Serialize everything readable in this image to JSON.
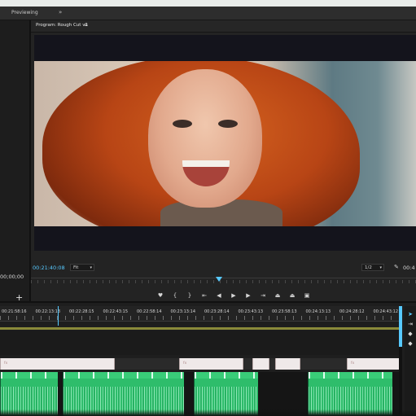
{
  "topbar": {
    "tab_label": "Previewing",
    "more_label": "»"
  },
  "source_panel": {
    "timecode": "00;00;00",
    "add_label": "+"
  },
  "program": {
    "title": "Program: Rough Cut v1",
    "menu_icon": "≡",
    "current_timecode": "00:21:40:08",
    "fit_value": "Fit",
    "resolution_value": "1/2",
    "end_timecode": "00:4"
  },
  "transport_icons": [
    "marker-icon",
    "in-point-icon",
    "out-point-icon",
    "go-to-in-icon",
    "step-back-icon",
    "play-icon",
    "step-forward-icon",
    "go-to-out-icon",
    "lift-icon",
    "extract-icon",
    "export-frame-icon"
  ],
  "transport_glyphs": [
    "♥",
    "{",
    "}",
    "⇤",
    "◀",
    "▶",
    "▶",
    "⇥",
    "⏏",
    "⏏",
    "▣"
  ],
  "timeline": {
    "ruler_labels": [
      "00:21:58:16",
      "00:22:13:13",
      "00:22:28:15",
      "00:22:43:15",
      "00:22:58:14",
      "00:23:13:14",
      "00:23:28:14",
      "00:23:43:13",
      "00:23:58:13",
      "00:24:13:13",
      "00:24:28:12",
      "00:24:43:12"
    ],
    "clip_text": "fx"
  },
  "colors": {
    "accent": "#57c9ff",
    "audio_clip": "#2ebd6b",
    "panel_bg": "#232323"
  }
}
